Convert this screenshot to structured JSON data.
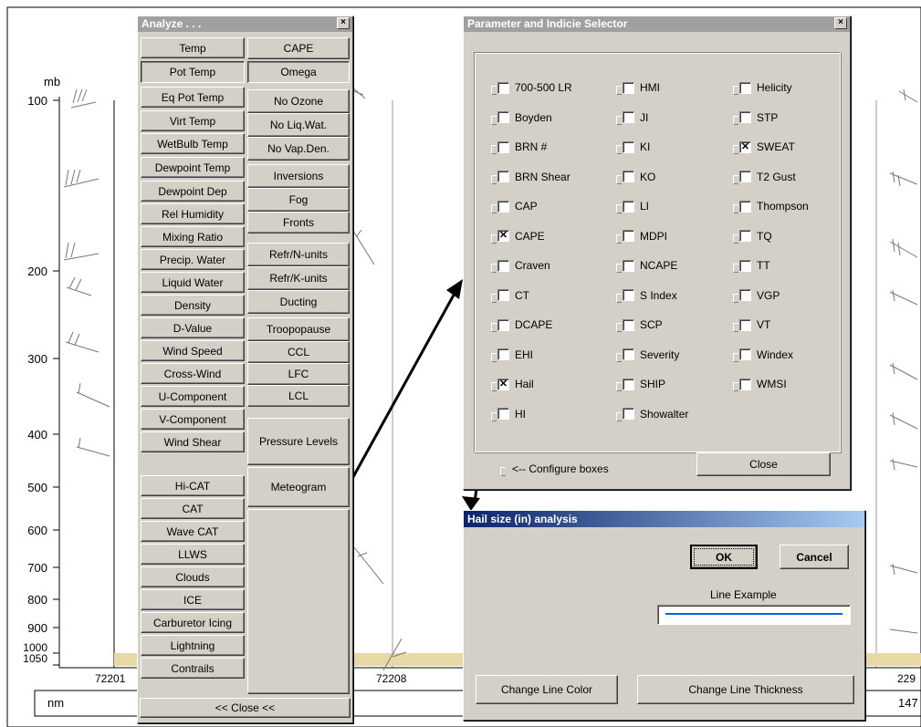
{
  "background": {
    "pressure_unit": "mb",
    "pressure_levels": [
      "100",
      "200",
      "300",
      "400",
      "500",
      "600",
      "700",
      "800",
      "900",
      "1000",
      "1050"
    ],
    "stations": [
      "72201",
      "72208",
      "229"
    ],
    "distance_unit": "nm",
    "distance_value": "147"
  },
  "analyze": {
    "title": "Analyze . . .",
    "close_x": "×",
    "left_buttons": [
      "Temp",
      "Pot Temp",
      "Eq Pot Temp",
      "Virt Temp",
      "WetBulb Temp",
      "Dewpoint Temp",
      "Dewpoint Dep",
      "Rel Humidity",
      "Mixing Ratio",
      "Precip. Water",
      "Liquid Water",
      "Density",
      "D-Value",
      "Wind Speed",
      "Cross-Wind",
      "U-Component",
      "V-Component",
      "Wind Shear",
      "Hi-CAT",
      "CAT",
      "Wave CAT",
      "LLWS",
      "Clouds",
      "ICE",
      "Carburetor Icing",
      "Lightning",
      "Contrails"
    ],
    "right_buttons": [
      "CAPE",
      "Omega",
      "No Ozone",
      "No Liq.Wat.",
      "No Vap.Den.",
      "Inversions",
      "Fog",
      "Fronts",
      "Refr/N-units",
      "Refr/K-units",
      "Ducting",
      "Troopopause",
      "CCL",
      "LFC",
      "LCL",
      "Pressure Levels",
      "Meteogram"
    ],
    "close_button": "<< Close <<"
  },
  "selector": {
    "title": "Parameter and Indicie Selector",
    "close_x": "×",
    "col1": [
      {
        "label": "700-500 LR",
        "checked": false
      },
      {
        "label": "Boyden",
        "checked": false
      },
      {
        "label": "BRN #",
        "checked": false
      },
      {
        "label": "BRN Shear",
        "checked": false
      },
      {
        "label": "CAP",
        "checked": false
      },
      {
        "label": "CAPE",
        "checked": true
      },
      {
        "label": "Craven",
        "checked": false
      },
      {
        "label": "CT",
        "checked": false
      },
      {
        "label": "DCAPE",
        "checked": false
      },
      {
        "label": "EHI",
        "checked": false
      },
      {
        "label": "Hail",
        "checked": true
      },
      {
        "label": "HI",
        "checked": false
      }
    ],
    "col2": [
      {
        "label": "HMI",
        "checked": false
      },
      {
        "label": "JI",
        "checked": false
      },
      {
        "label": "KI",
        "checked": false
      },
      {
        "label": "KO",
        "checked": false
      },
      {
        "label": "LI",
        "checked": false
      },
      {
        "label": "MDPI",
        "checked": false
      },
      {
        "label": "NCAPE",
        "checked": false
      },
      {
        "label": "S Index",
        "checked": false
      },
      {
        "label": "SCP",
        "checked": false
      },
      {
        "label": "Severity",
        "checked": false
      },
      {
        "label": "SHIP",
        "checked": false
      },
      {
        "label": "Showalter",
        "checked": false
      }
    ],
    "col3": [
      {
        "label": "Helicity",
        "checked": false
      },
      {
        "label": "STP",
        "checked": false
      },
      {
        "label": "SWEAT",
        "checked": true
      },
      {
        "label": "T2 Gust",
        "checked": false
      },
      {
        "label": "Thompson",
        "checked": false
      },
      {
        "label": "TQ",
        "checked": false
      },
      {
        "label": "TT",
        "checked": false
      },
      {
        "label": "VGP",
        "checked": false
      },
      {
        "label": "VT",
        "checked": false
      },
      {
        "label": "Windex",
        "checked": false
      },
      {
        "label": "WMSI",
        "checked": false
      }
    ],
    "configure_label": "<-- Configure boxes",
    "close_button": "Close"
  },
  "hail": {
    "title": "Hail size (in)  analysis",
    "ok": "OK",
    "cancel": "Cancel",
    "line_example_label": "Line Example",
    "line_color": "#0a64d8",
    "change_color": "Change Line Color",
    "change_thickness": "Change Line Thickness"
  }
}
